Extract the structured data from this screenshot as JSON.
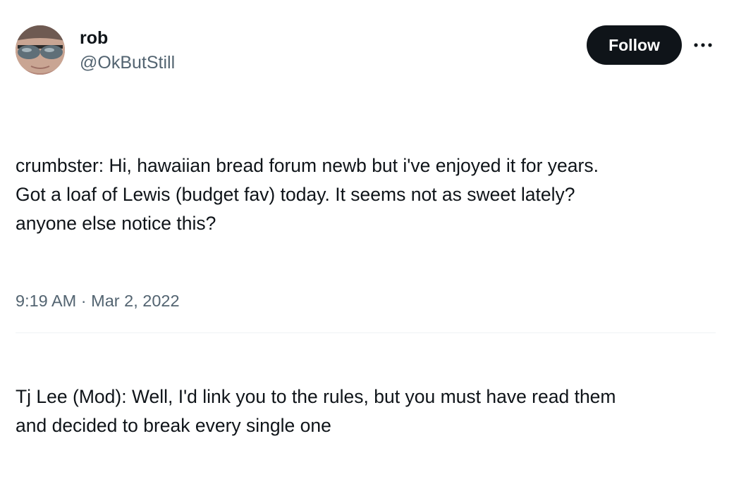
{
  "author": {
    "display_name": "rob",
    "handle": "@OkButStill",
    "avatar_icon": "profile-photo-sunglasses"
  },
  "actions": {
    "follow_label": "Follow",
    "more_icon": "more-horizontal-icon"
  },
  "tweet": {
    "paragraphs": [
      "crumbster: Hi, hawaiian bread forum newb but i've enjoyed it for years.\nGot a loaf of Lewis (budget fav) today. It seems not as sweet lately?\nanyone else notice this?",
      "Tj Lee (Mod): Well, I'd link you to the rules, but you must have read them\nand decided to break every single one"
    ],
    "time": "9:19 AM",
    "separator": "·",
    "date": "Mar 2, 2022"
  },
  "colors": {
    "text_primary": "#0f1419",
    "text_secondary": "#536471",
    "button_bg": "#0f1419",
    "button_text": "#ffffff",
    "divider": "#eff3f4"
  }
}
